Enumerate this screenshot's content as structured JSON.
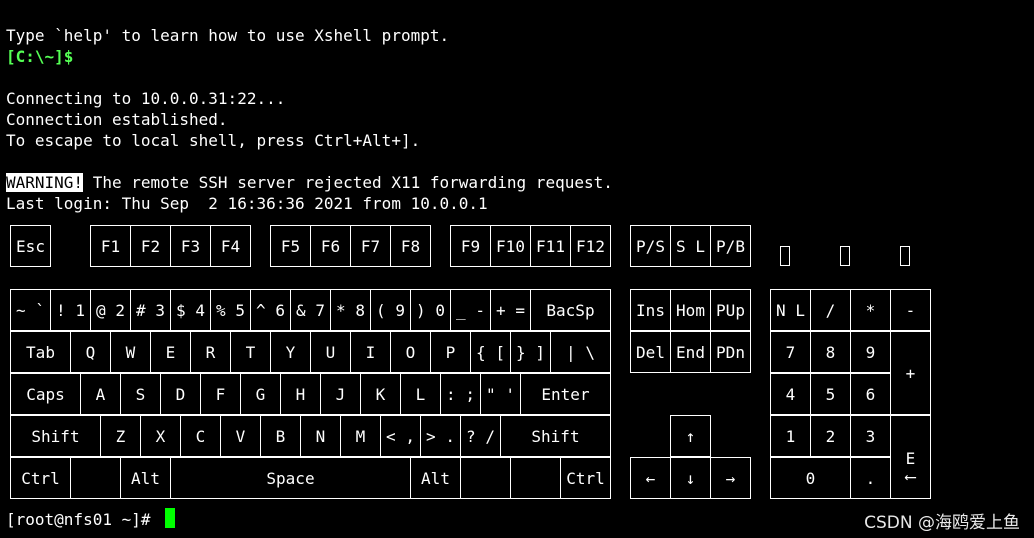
{
  "terminal": {
    "line_help": "Type `help' to learn how to use Xshell prompt.",
    "local_prompt": "[C:\\~]$",
    "line_connecting": "Connecting to 10.0.0.31:22...",
    "line_established": "Connection established.",
    "line_escape": "To escape to local shell, press Ctrl+Alt+].",
    "warning_tag": "WARNING!",
    "warning_text": " The remote SSH server rejected X11 forwarding request.",
    "last_login": "Last login: Thu Sep  2 16:36:36 2021 from 10.0.0.1",
    "remote_prompt": "[root@nfs01 ~]# "
  },
  "keys": {
    "esc": "Esc",
    "f1": "F1",
    "f2": "F2",
    "f3": "F3",
    "f4": "F4",
    "f5": "F5",
    "f6": "F6",
    "f7": "F7",
    "f8": "F8",
    "f9": "F9",
    "f10": "F10",
    "f11": "F11",
    "f12": "F12",
    "ps": "P/S",
    "sl": "S L",
    "pb": "P/B",
    "tilde": "~ `",
    "k1": "! 1",
    "k2": "@ 2",
    "k3": "# 3",
    "k4": "$ 4",
    "k5": "% 5",
    "k6": "^ 6",
    "k7": "& 7",
    "k8": "* 8",
    "k9": "( 9",
    "k0": ") 0",
    "minus": "_ -",
    "equals": "+ =",
    "backspace": "BacSp",
    "tab": "Tab",
    "q": "Q",
    "w": "W",
    "e": "E",
    "r": "R",
    "t": "T",
    "y": "Y",
    "u": "U",
    "i": "I",
    "o": "O",
    "p": "P",
    "lbracket": "{ [",
    "rbracket": "} ]",
    "backslash": "| \\",
    "caps": "Caps",
    "a": "A",
    "s": "S",
    "d": "D",
    "f": "F",
    "g": "G",
    "h": "H",
    "j": "J",
    "k": "K",
    "l": "L",
    "semicolon": ": ;",
    "quote": "\" '",
    "enter": "Enter",
    "lshift": "Shift",
    "z": "Z",
    "x": "X",
    "c": "C",
    "v": "V",
    "b": "B",
    "n": "N",
    "m": "M",
    "comma": "< ,",
    "period": "> .",
    "slash": "? /",
    "rshift": "Shift",
    "lctrl": "Ctrl",
    "lalt": "Alt",
    "space": "Space",
    "ralt": "Alt",
    "rctrl": "Ctrl",
    "ins": "Ins",
    "home": "Hom",
    "pgup": "PUp",
    "del": "Del",
    "end": "End",
    "pgdn": "PDn",
    "up": "↑",
    "left": "←",
    "down": "↓",
    "right": "→",
    "numlock": "N L",
    "npdiv": "/",
    "npmul": "*",
    "npminus": "-",
    "np7": "7",
    "np8": "8",
    "np9": "9",
    "npplus": "+",
    "np4": "4",
    "np5": "5",
    "np6": "6",
    "np1": "1",
    "np2": "2",
    "np3": "3",
    "npenter": "E\n⟵",
    "np0": "0",
    "npdot": "."
  },
  "watermark": "CSDN @海鸥爱上鱼"
}
